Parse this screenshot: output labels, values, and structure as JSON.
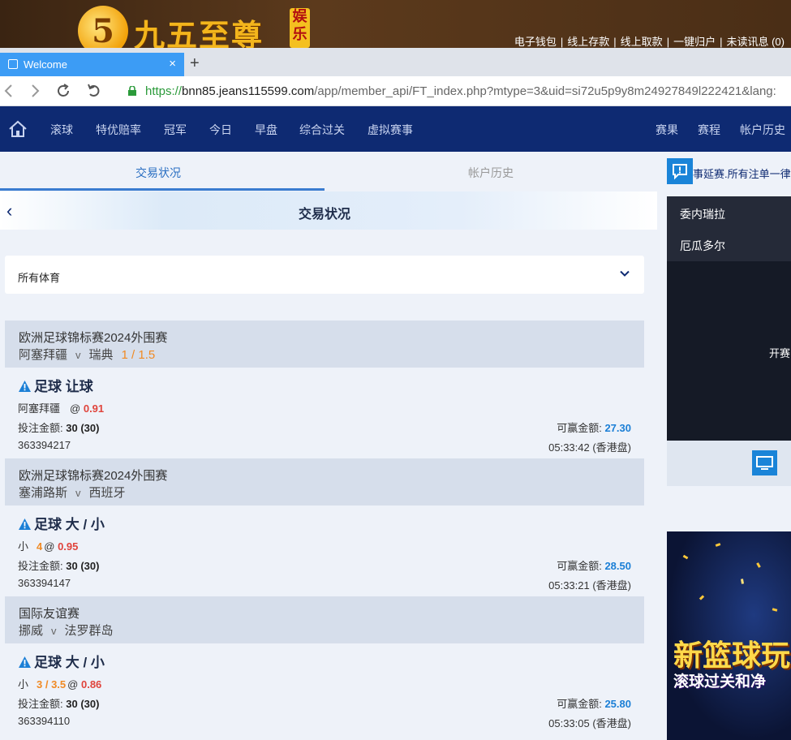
{
  "banner": {
    "logo_glyph": "5",
    "logo_text": "九五至尊",
    "badge_text": "娱乐",
    "links": [
      "电子钱包",
      "线上存款",
      "线上取款",
      "一键归户",
      "未读讯息 (0)"
    ]
  },
  "browser": {
    "tab_title": "Welcome",
    "tab_close": "×",
    "new_tab": "+",
    "url_proto": "https://",
    "url_host": "bnn85.jeans115599.com",
    "url_path": "/app/member_api/FT_index.php?mtype=3&uid=si72u5p9y8m24927849l222421&lang:"
  },
  "nav": {
    "left_items": [
      "滚球",
      "特优赔率",
      "冠军",
      "今日",
      "早盘",
      "综合过关",
      "虚拟赛事"
    ],
    "right_items": [
      "赛果",
      "赛程",
      "帐户历史"
    ]
  },
  "subtabs": {
    "active": "交易状况",
    "inactive": "帐户历史"
  },
  "page": {
    "title": "交易状况",
    "back": "‹"
  },
  "filter": {
    "label": "所有体育"
  },
  "bets": [
    {
      "league": "欧洲足球锦标赛2024外围赛",
      "home": "阿塞拜疆",
      "vs": "v",
      "away": "瑞典",
      "handicap": "1 / 1.5",
      "type": "足球 让球",
      "selection": "阿塞拜疆",
      "line": "",
      "at": "@",
      "odds": "0.91",
      "stake_label": "投注金额:",
      "stake": "30 (30)",
      "win_label": "可赢金额:",
      "win": "27.30",
      "ticket_id": "363394217",
      "time": "05:33:42 (香港盘)"
    },
    {
      "league": "欧洲足球锦标赛2024外围赛",
      "home": "塞浦路斯",
      "vs": "v",
      "away": "西班牙",
      "handicap": "",
      "type": "足球 大 / 小",
      "selection": "小",
      "line": "4",
      "at": "@",
      "odds": "0.95",
      "stake_label": "投注金额:",
      "stake": "30 (30)",
      "win_label": "可赢金额:",
      "win": "28.50",
      "ticket_id": "363394147",
      "time": "05:33:21 (香港盘)"
    },
    {
      "league": "国际友谊赛",
      "home": "挪威",
      "vs": "v",
      "away": "法罗群岛",
      "handicap": "",
      "type": "足球 大 / 小",
      "selection": "小",
      "line": "3 / 3.5",
      "at": "@",
      "odds": "0.86",
      "stake_label": "投注金额:",
      "stake": "30 (30)",
      "win_label": "可赢金额:",
      "win": "25.80",
      "ticket_id": "363394110",
      "time": "05:33:05 (香港盘)"
    }
  ],
  "right_panel": {
    "notice": "事延赛.所有注单一律",
    "team_a": "委内瑞拉",
    "team_b": "厄瓜多尔",
    "start_text": "开赛",
    "promo_big": "新篮球玩",
    "promo_small": "滚球过关和净"
  },
  "colors": {
    "nav_bg": "#0e2a72",
    "accent_blue": "#1b7fd6",
    "odds_red": "#e0443c",
    "line_orange": "#f08a24",
    "card_head": "#d6deeb"
  }
}
